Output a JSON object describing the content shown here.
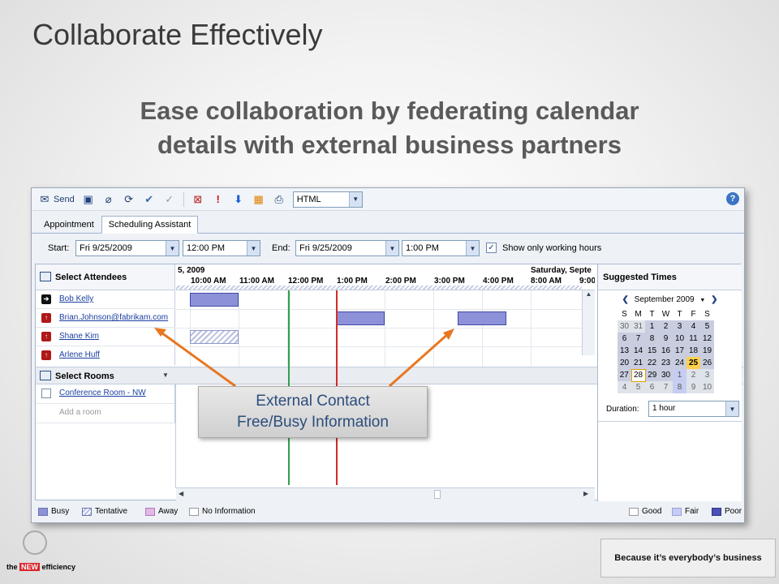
{
  "slide": {
    "title": "Collaborate Effectively",
    "subtitle_line1": "Ease collaboration by federating calendar",
    "subtitle_line2": "details with external business partners"
  },
  "toolbar": {
    "send_label": "Send",
    "format_value": "HTML",
    "help": "?"
  },
  "tabs": [
    {
      "label": "Appointment",
      "active": false
    },
    {
      "label": "Scheduling Assistant",
      "active": true
    }
  ],
  "dates": {
    "start_label": "Start:",
    "start_date": "Fri 9/25/2009",
    "start_time": "12:00 PM",
    "end_label": "End:",
    "end_date": "Fri 9/25/2009",
    "end_time": "1:00 PM",
    "working_hours_label": "Show only working hours",
    "working_hours_checked": true
  },
  "attendees": {
    "header": "Select Attendees",
    "rows": [
      {
        "name": "Bob Kelly"
      },
      {
        "name": "Brian.Johnson@fabrikam.com"
      },
      {
        "name": "Shane Kim"
      },
      {
        "name": "Arlene Huff"
      }
    ],
    "rooms_header": "Select Rooms",
    "room": "Conference Room - NW",
    "add_room_placeholder": "Add a room"
  },
  "timeline": {
    "day1": "5, 2009",
    "day2": "Saturday, Septe",
    "hours": [
      "10:00 AM",
      "11:00 AM",
      "12:00 PM",
      "1:00 PM",
      "2:00 PM",
      "3:00 PM",
      "4:00 PM"
    ],
    "hours_day2": [
      "8:00 AM",
      "9:00"
    ]
  },
  "suggested": {
    "header": "Suggested Times",
    "month": "September 2009",
    "weekdays": [
      "S",
      "M",
      "T",
      "W",
      "T",
      "F",
      "S"
    ],
    "weeks": [
      [
        "30",
        "31",
        "1",
        "2",
        "3",
        "4",
        "5"
      ],
      [
        "6",
        "7",
        "8",
        "9",
        "10",
        "11",
        "12"
      ],
      [
        "13",
        "14",
        "15",
        "16",
        "17",
        "18",
        "19"
      ],
      [
        "20",
        "21",
        "22",
        "23",
        "24",
        "25",
        "26"
      ],
      [
        "27",
        "28",
        "29",
        "30",
        "1",
        "2",
        "3"
      ],
      [
        "4",
        "5",
        "6",
        "7",
        "8",
        "9",
        "10"
      ]
    ],
    "duration_label": "Duration:",
    "duration_value": "1 hour"
  },
  "legend": {
    "busy": "Busy",
    "tentative": "Tentative",
    "away": "Away",
    "no_info": "No Information",
    "good": "Good",
    "fair": "Fair",
    "poor": "Poor"
  },
  "callout": {
    "line1": "External Contact",
    "line2": "Free/Busy Information"
  },
  "branding": {
    "banner": "Because it’s everybody’s business",
    "logo_text_1": "the",
    "logo_text_2": "NEW",
    "logo_text_3": "efficiency"
  },
  "colors": {
    "busy": "#8d92d8",
    "start_line": "#2ea04a",
    "end_line": "#d42a2a",
    "arrow": "#e87722",
    "today": "#ffd050"
  }
}
